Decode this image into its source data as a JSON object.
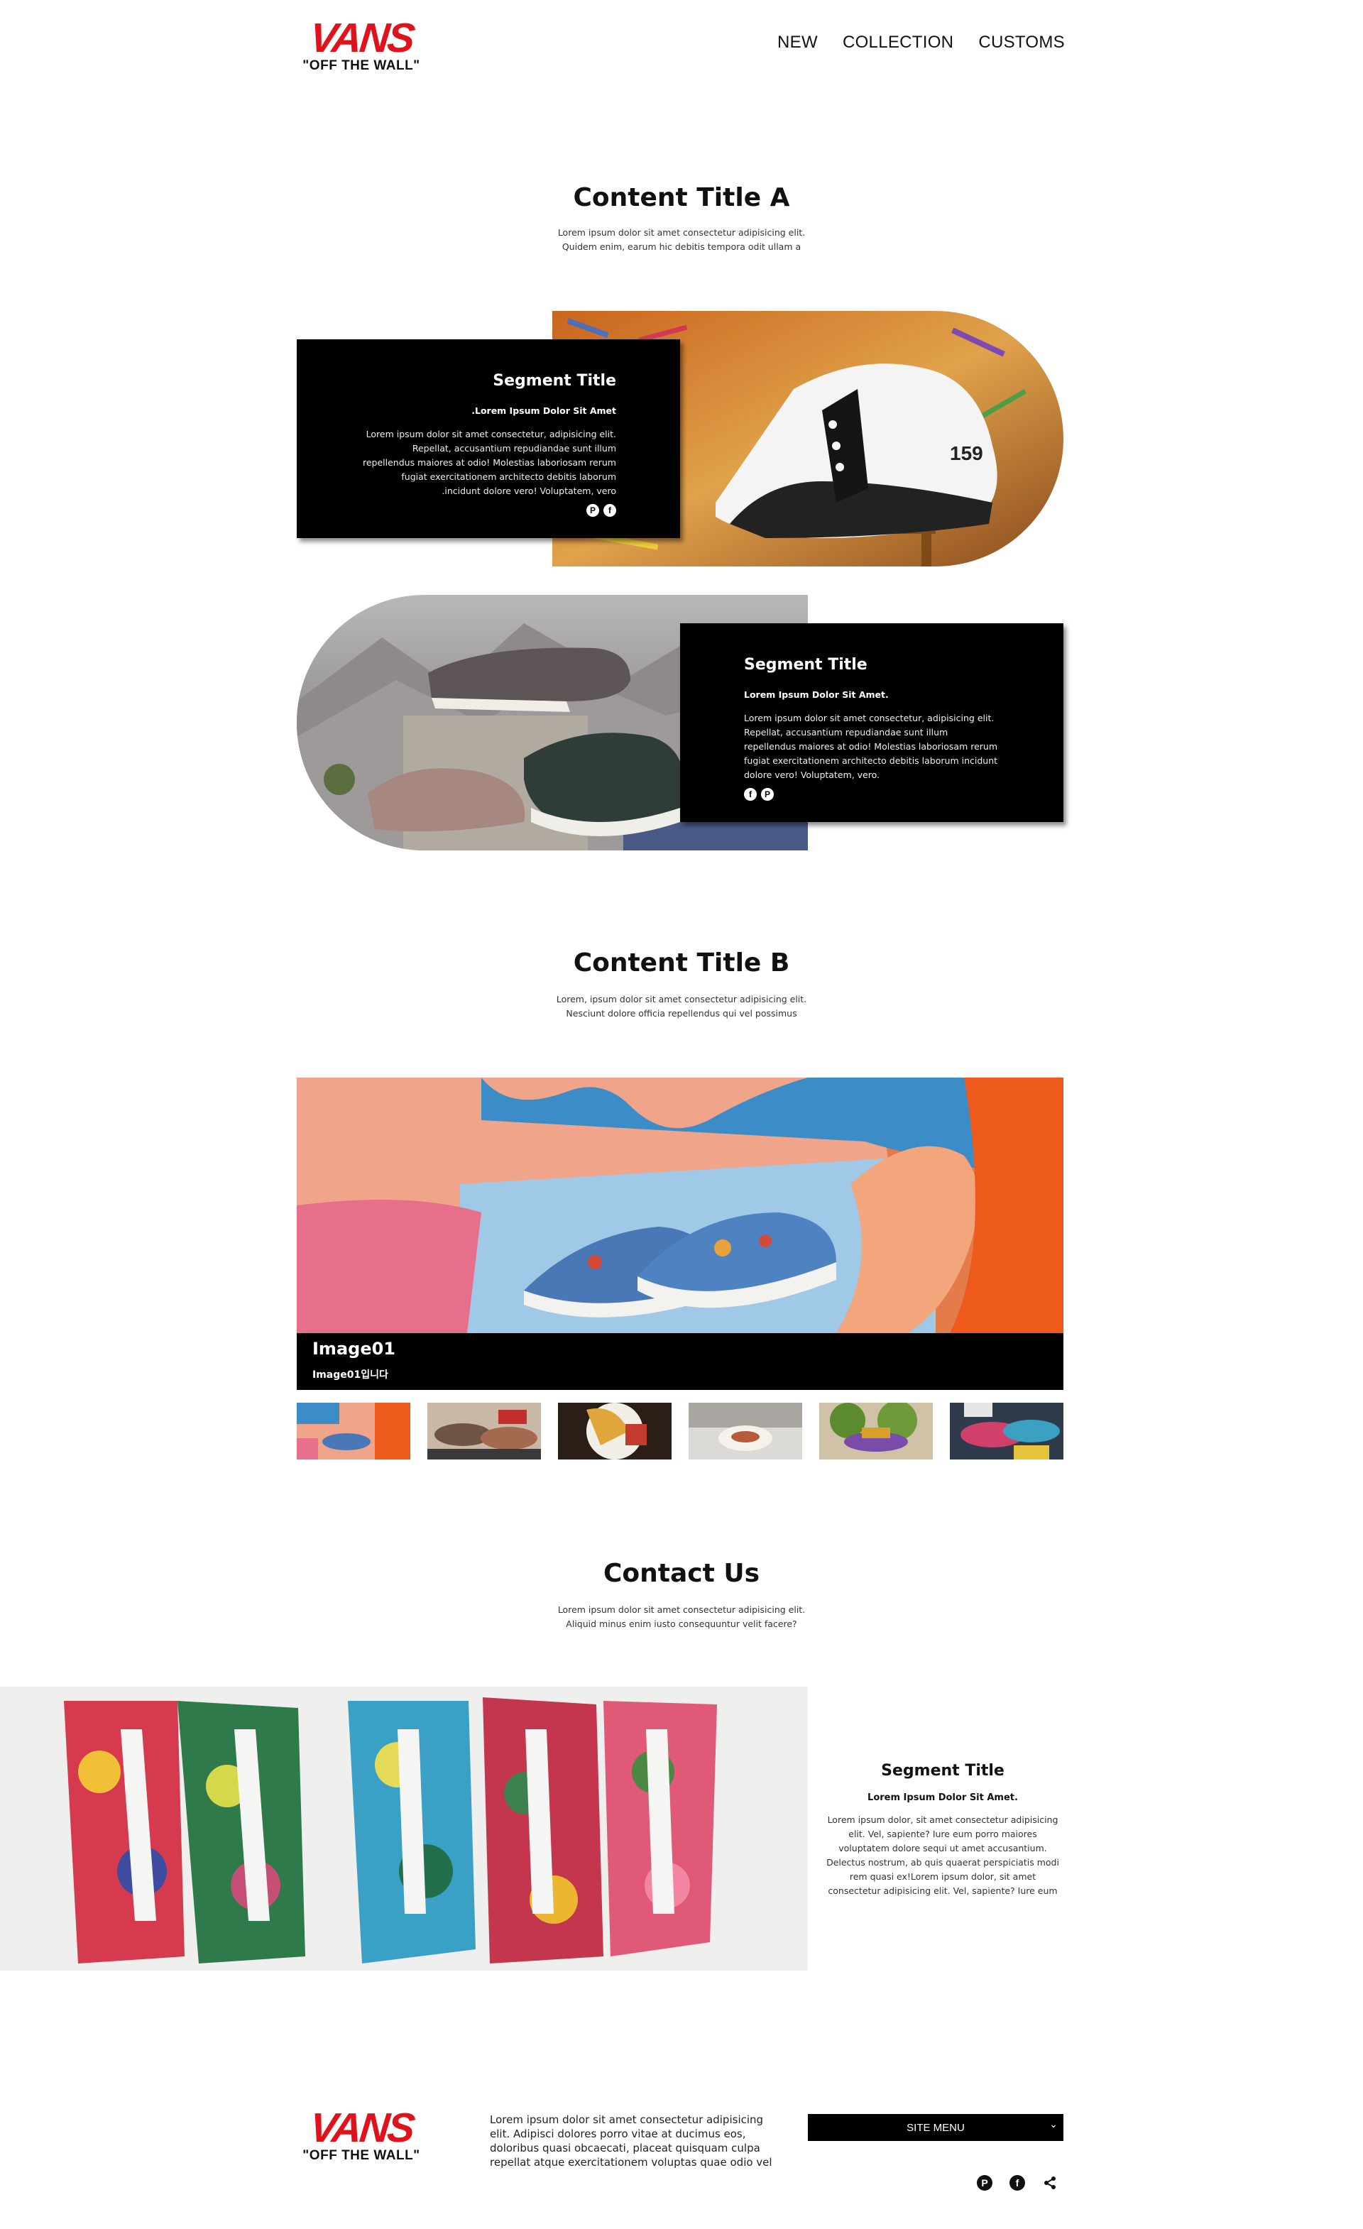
{
  "header": {
    "logo": {
      "brand": "VANS",
      "tagline": "\"OFF THE WALL\""
    },
    "nav": [
      "NEW",
      "COLLECTION",
      "CUSTOMS"
    ]
  },
  "section_a": {
    "title": "Content Title A",
    "desc_line1": "Lorem ipsum dolor sit amet consectetur adipisicing elit.",
    "desc_line2": "Quidem enim, earum hic debitis tempora odit ullam a",
    "segment1": {
      "title": "Segment Title",
      "subtitle": ".Lorem Ipsum Dolor Sit Amet",
      "body": "Lorem ipsum dolor sit amet consectetur, adipisicing elit. Repellat, accusantium repudiandae sunt illum repellendus maiores at odio! Molestias laboriosam rerum fugiat exercitationem architecto debitis laborum .incidunt dolore vero! Voluptatem, vero",
      "icons": [
        "pinterest-icon",
        "facebook-icon"
      ]
    },
    "segment2": {
      "title": "Segment Title",
      "subtitle": "Lorem Ipsum Dolor Sit Amet.",
      "body": "Lorem ipsum dolor sit amet consectetur, adipisicing elit. Repellat, accusantium repudiandae sunt illum repellendus maiores at odio! Molestias laboriosam rerum fugiat exercitationem architecto debitis laborum incidunt dolore vero! Voluptatem, vero.",
      "icons": [
        "facebook-icon",
        "pinterest-icon"
      ]
    }
  },
  "section_b": {
    "title": "Content Title B",
    "desc_line1": "Lorem, ipsum dolor sit amet consectetur adipisicing elit.",
    "desc_line2": "Nesciunt dolore officia repellendus qui vel possimus",
    "gallery": {
      "caption_title": "Image01",
      "caption_sub": "Image01입니다",
      "thumbnails": 6
    }
  },
  "contact": {
    "title": "Contact Us",
    "desc_line1": "Lorem ipsum dolor sit amet consectetur adipisicing elit.",
    "desc_line2": "Aliquid minus enim iusto consequuntur velit facere?",
    "segment": {
      "title": "Segment Title",
      "subtitle": "Lorem Ipsum Dolor Sit Amet.",
      "body": "Lorem ipsum dolor, sit amet consectetur adipisicing elit. Vel, sapiente? Iure eum porro maiores voluptatem dolore sequi ut amet accusantium. Delectus nostrum, ab quis quaerat perspiciatis modi rem quasi ex!Lorem ipsum dolor, sit amet consectetur adipisicing elit. Vel, sapiente? Iure eum"
    }
  },
  "footer": {
    "logo": {
      "brand": "VANS",
      "tagline": "\"OFF THE WALL\""
    },
    "text": "Lorem ipsum dolor sit amet consectetur adipisicing elit. Adipisci dolores porro vitae at ducimus eos, doloribus quasi obcaecati, placeat quisquam culpa repellat atque exercitationem voluptas quae odio vel",
    "site_menu": "SITE MENU",
    "icons": [
      "pinterest-icon",
      "facebook-icon",
      "share-icon"
    ]
  },
  "colors": {
    "brand_red": "#e0121b",
    "black": "#000000"
  }
}
